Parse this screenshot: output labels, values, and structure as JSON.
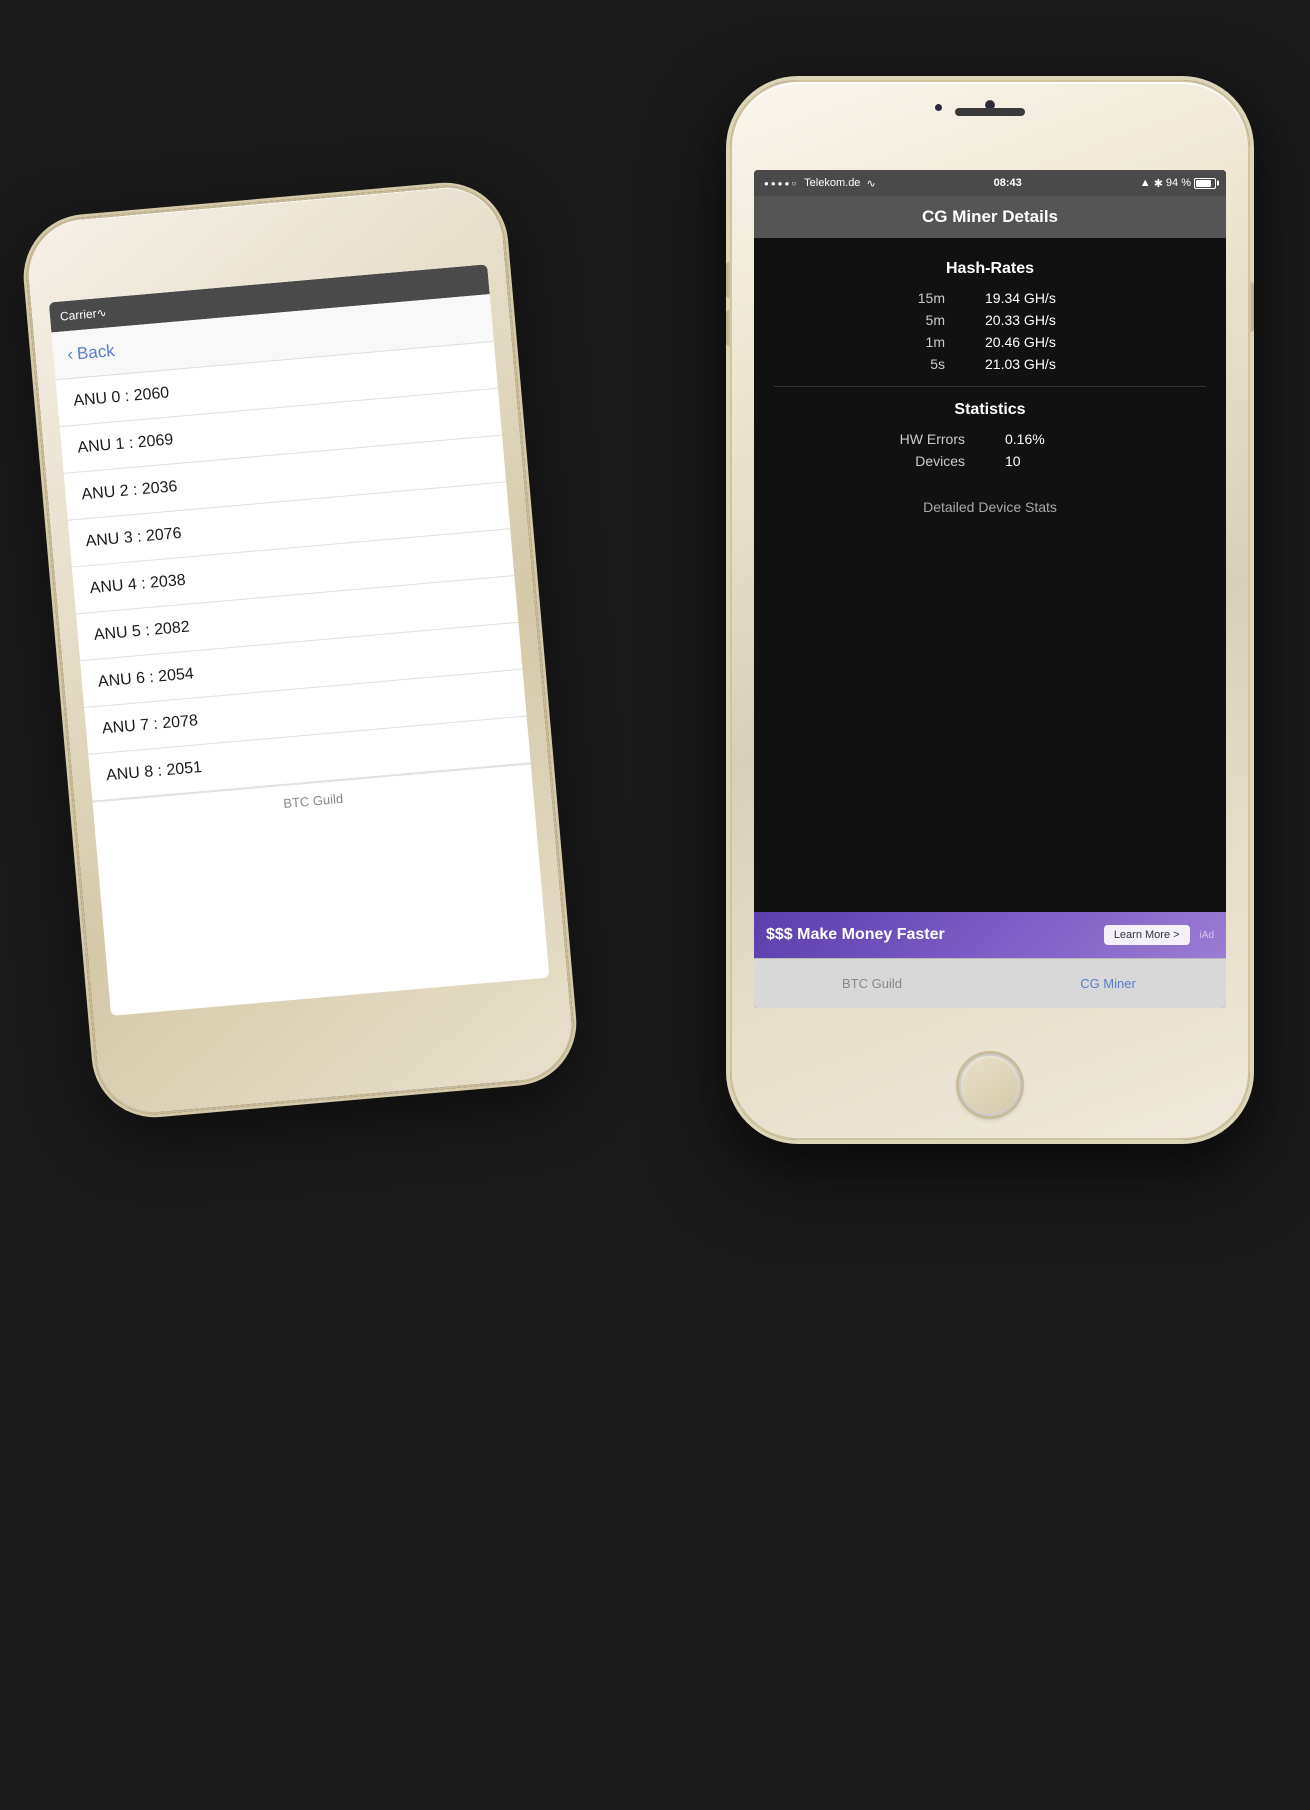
{
  "back_phone": {
    "status_bar": {
      "carrier": "Carrier",
      "wifi_icon": "wifi"
    },
    "nav": {
      "back_label": "Back"
    },
    "list_items": [
      "ANU 0 : 2060",
      "ANU 1 : 2069",
      "ANU 2 : 2036",
      "ANU 3 : 2076",
      "ANU 4 : 2038",
      "ANU 5 : 2082",
      "ANU 6 : 2054",
      "ANU 7 : 2078",
      "ANU 8 : 2051"
    ],
    "footer": "BTC Guild"
  },
  "front_phone": {
    "status_bar": {
      "carrier": "●●●●○ Telekom.de",
      "wifi": "▾",
      "time": "08:43",
      "gps": "▲",
      "bt": "✱",
      "battery_pct": "94 %"
    },
    "nav": {
      "title": "CG Miner Details"
    },
    "hash_rates": {
      "section_title": "Hash-Rates",
      "rows": [
        {
          "label": "15m",
          "value": "19.34 GH/s"
        },
        {
          "label": "5m",
          "value": "20.33 GH/s"
        },
        {
          "label": "1m",
          "value": "20.46 GH/s"
        },
        {
          "label": "5s",
          "value": "21.03 GH/s"
        }
      ]
    },
    "statistics": {
      "section_title": "Statistics",
      "rows": [
        {
          "label": "HW Errors",
          "value": "0.16%"
        },
        {
          "label": "Devices",
          "value": "10"
        }
      ]
    },
    "detailed_device_stats": "Detailed Device Stats",
    "ad": {
      "text": "$$$ Make Money Faster",
      "button": "Learn More >",
      "label": "iAd"
    },
    "tabs": [
      {
        "label": "BTC Guild",
        "active": false
      },
      {
        "label": "CG Miner",
        "active": true
      }
    ]
  }
}
